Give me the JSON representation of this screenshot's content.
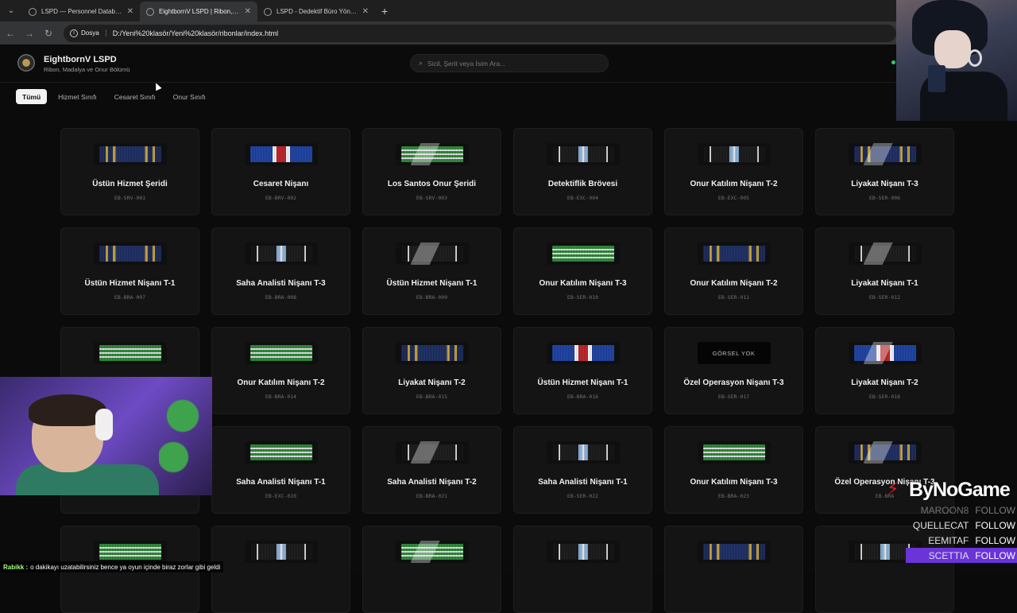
{
  "browser": {
    "tabs": [
      {
        "label": "LSPD — Personnel Database",
        "active": false
      },
      {
        "label": "EightbornV LSPD | Ribon, Madalya",
        "active": true
      },
      {
        "label": "LSPD - Dedektif Büro Yönetim",
        "active": false
      }
    ],
    "scheme_label": "Dosya",
    "url": "D:/Yeni%20klasör/Yeni%20klasör/ribonlar/index.html"
  },
  "header": {
    "title": "EightbornV LSPD",
    "subtitle": "Ribon, Madalya ve Onur Bölümü",
    "search_placeholder": "Sicil, Şerit veya İsim Ara..."
  },
  "filters": [
    {
      "label": "Tümü",
      "active": true
    },
    {
      "label": "Hizmet Sınıfı",
      "active": false
    },
    {
      "label": "Cesaret Sınıfı",
      "active": false
    },
    {
      "label": "Onur Sınıfı",
      "active": false
    }
  ],
  "ribbons": [
    {
      "title": "Üstün Hizmet Şeridi",
      "code": "EB-SRV-001",
      "style": "navy-gold",
      "gloss": false
    },
    {
      "title": "Cesaret Nişanı",
      "code": "EB-BRV-002",
      "style": "blue-red",
      "gloss": false
    },
    {
      "title": "Los Santos Onur Şeridi",
      "code": "EB-SRV-003",
      "style": "green",
      "gloss": true
    },
    {
      "title": "Detektiflik Brövesi",
      "code": "EB-EXC-004",
      "style": "black-blue",
      "gloss": false
    },
    {
      "title": "Onur Katılım Nişanı T-2",
      "code": "EB-EXC-005",
      "style": "black-blue",
      "gloss": false
    },
    {
      "title": "Liyakat Nişanı T-3",
      "code": "EB-SER-006",
      "style": "navy-gold",
      "gloss": true
    },
    {
      "title": "Üstün Hizmet Nişanı T-1",
      "code": "EB-BRA-007",
      "style": "navy-gold",
      "gloss": false
    },
    {
      "title": "Saha Analisti Nişanı T-3",
      "code": "EB-BRA-008",
      "style": "black-blue",
      "gloss": false
    },
    {
      "title": "Üstün Hizmet Nişanı T-1",
      "code": "EB-BRA-009",
      "style": "black-white",
      "gloss": true
    },
    {
      "title": "Onur Katılım Nişanı T-3",
      "code": "EB-SER-010",
      "style": "green",
      "gloss": false
    },
    {
      "title": "Onur Katılım Nişanı T-2",
      "code": "EB-SER-011",
      "style": "navy-gold",
      "gloss": false
    },
    {
      "title": "Liyakat Nişanı T-1",
      "code": "EB-SER-012",
      "style": "black-white",
      "gloss": true
    },
    {
      "title": "",
      "code": "",
      "style": "green",
      "gloss": false
    },
    {
      "title": "Onur Katılım Nişanı T-2",
      "code": "EB-BRA-014",
      "style": "green",
      "gloss": false
    },
    {
      "title": "Liyakat Nişanı T-2",
      "code": "EB-BRA-015",
      "style": "navy-gold",
      "gloss": false
    },
    {
      "title": "Üstün Hizmet Nişanı T-1",
      "code": "EB-BRA-016",
      "style": "blue-red",
      "gloss": false
    },
    {
      "title": "Özel Operasyon Nişanı T-3",
      "code": "EB-SER-017",
      "style": "none",
      "gloss": false
    },
    {
      "title": "Liyakat Nişanı T-2",
      "code": "EB-SER-018",
      "style": "blue-red",
      "gloss": true
    },
    {
      "title": "",
      "code": "",
      "style": "none",
      "gloss": false
    },
    {
      "title": "Saha Analisti Nişanı T-1",
      "code": "EB-EXC-020",
      "style": "green",
      "gloss": false
    },
    {
      "title": "Saha Analisti Nişanı T-2",
      "code": "EB-BRA-021",
      "style": "black-white",
      "gloss": true
    },
    {
      "title": "Saha Analisti Nişanı T-1",
      "code": "EB-SER-022",
      "style": "black-blue",
      "gloss": false
    },
    {
      "title": "Onur Katılım Nişanı T-3",
      "code": "EB-BRA-023",
      "style": "green",
      "gloss": false
    },
    {
      "title": "Özel Operasyon Nişanı T-3",
      "code": "EB-BRA",
      "style": "navy-gold",
      "gloss": true
    },
    {
      "title": "",
      "code": "",
      "style": "green",
      "gloss": false
    },
    {
      "title": "",
      "code": "",
      "style": "black-blue",
      "gloss": false
    },
    {
      "title": "",
      "code": "",
      "style": "green",
      "gloss": true
    },
    {
      "title": "",
      "code": "",
      "style": "black-blue",
      "gloss": false
    },
    {
      "title": "",
      "code": "",
      "style": "navy-gold",
      "gloss": false
    },
    {
      "title": "",
      "code": "",
      "style": "black-blue",
      "gloss": false
    }
  ],
  "no_image_label": "GÖRSEL YOK",
  "overlay": {
    "brand": "ByNoGame",
    "follows": [
      {
        "name": "MAROON8",
        "label": "FOLLOW",
        "state": "dim"
      },
      {
        "name": "QUELLECAT",
        "label": "FOLLOW",
        "state": "normal"
      },
      {
        "name": "EEMITAF",
        "label": "FOLLOW",
        "state": "normal"
      },
      {
        "name": "SCETTIA",
        "label": "FOLLOW",
        "state": "highlight"
      }
    ],
    "chat": {
      "user": "Rabikk :",
      "message": "o dakikayı uzatabilirsiniz bence ya oyun içinde biraz zorlar gibi geldi"
    }
  }
}
